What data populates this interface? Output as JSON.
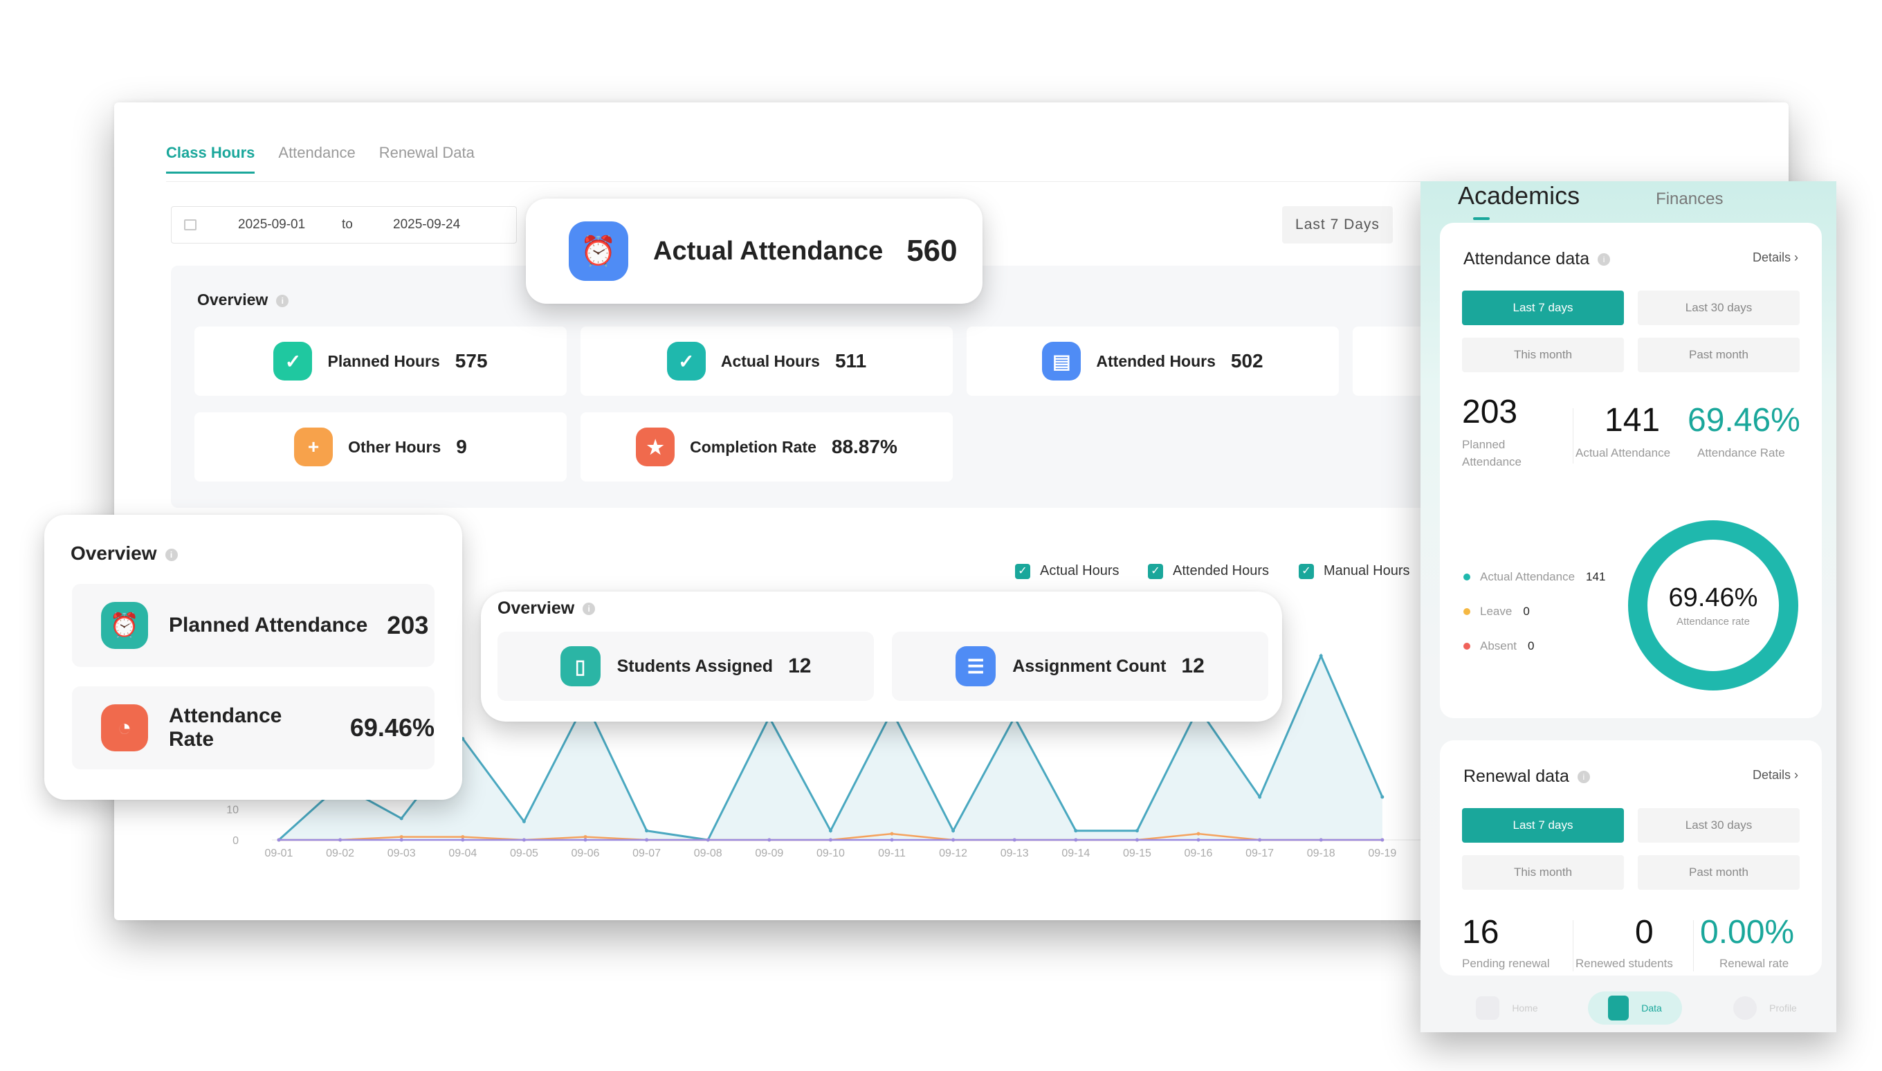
{
  "dashboard": {
    "tabs": [
      {
        "label": "Class Hours"
      },
      {
        "label": "Attendance"
      },
      {
        "label": "Renewal Data"
      }
    ],
    "date_range": {
      "start": "2025-09-01",
      "separator": "to",
      "end": "2025-09-24"
    },
    "range_button": "Last 7 Days",
    "overview": {
      "title": "Overview",
      "metrics": [
        {
          "label": "Planned Hours",
          "value": "575",
          "color": "#1fc8a0"
        },
        {
          "label": "Actual Hours",
          "value": "511",
          "color": "#1fb8ad"
        },
        {
          "label": "Attended Hours",
          "value": "502",
          "color": "#4f8cf5"
        },
        {
          "label": "Other Hours",
          "value": "9",
          "color": "#f7a24b"
        },
        {
          "label": "Completion Rate",
          "value": "88.87%",
          "color": "#f06a4d"
        }
      ]
    },
    "legend": [
      {
        "label": "Actual Hours"
      },
      {
        "label": "Attended Hours"
      },
      {
        "label": "Manual Hours"
      }
    ]
  },
  "chart_data": {
    "type": "area",
    "x": [
      "09-01",
      "09-02",
      "09-03",
      "09-04",
      "09-05",
      "09-06",
      "09-07",
      "09-08",
      "09-09",
      "09-10",
      "09-11",
      "09-12",
      "09-13",
      "09-14",
      "09-15",
      "09-16",
      "09-17",
      "09-18",
      "09-19"
    ],
    "yticks": [
      "0",
      "10"
    ],
    "ylim": [
      0,
      60
    ],
    "series": [
      {
        "name": "Actual Hours",
        "color": "#4aa8c0",
        "values": [
          0,
          18,
          7,
          33,
          6,
          45,
          3,
          0,
          40,
          3,
          42,
          3,
          40,
          3,
          3,
          43,
          14,
          60,
          14
        ]
      },
      {
        "name": "Attended Hours",
        "color": "#f5a25d",
        "values": [
          0,
          0,
          1,
          1,
          0,
          1,
          0,
          0,
          0,
          0,
          2,
          0,
          0,
          0,
          0,
          2,
          0,
          0,
          0
        ]
      },
      {
        "name": "Manual Hours",
        "color": "#9b8be0",
        "values": [
          0,
          0,
          0,
          0,
          0,
          0,
          0,
          0,
          0,
          0,
          0,
          0,
          0,
          0,
          0,
          0,
          0,
          0,
          0
        ]
      }
    ]
  },
  "actual_attendance_card": {
    "label": "Actual Attendance",
    "value": "560",
    "color": "#4f8cf5"
  },
  "overview_card": {
    "title": "Overview",
    "rows": [
      {
        "label": "Planned Attendance",
        "value": "203",
        "color": "#2bb5a5"
      },
      {
        "label": "Attendance Rate",
        "value": "69.46%",
        "color": "#f06a4d"
      }
    ]
  },
  "overview_card2": {
    "title": "Overview",
    "rows": [
      {
        "label": "Students Assigned",
        "value": "12",
        "color": "#2bb5a5"
      },
      {
        "label": "Assignment Count",
        "value": "12",
        "color": "#4f8cf5"
      }
    ]
  },
  "mobile": {
    "tabs": {
      "active": "Academics",
      "other": "Finances"
    },
    "attendance": {
      "title": "Attendance data",
      "details": "Details",
      "segments": [
        "Last 7 days",
        "Last 30 days",
        "This month",
        "Past month"
      ],
      "planned": {
        "value": "203",
        "caption1": "Planned",
        "caption2": "Attendance"
      },
      "actual": {
        "value": "141",
        "caption": "Actual Attendance"
      },
      "rate": {
        "value": "69.46%",
        "caption": "Attendance Rate"
      },
      "legend": [
        {
          "label": "Actual Attendance",
          "value": "141",
          "color": "#1fb8ad"
        },
        {
          "label": "Leave",
          "value": "0",
          "color": "#f5b843"
        },
        {
          "label": "Absent",
          "value": "0",
          "color": "#f0625a"
        }
      ],
      "donut": {
        "percent": "69.46%",
        "label": "Attendance rate",
        "color": "#1fb8ad"
      }
    },
    "renewal": {
      "title": "Renewal data",
      "details": "Details",
      "segments": [
        "Last 7 days",
        "Last 30 days",
        "This month",
        "Past month"
      ],
      "pending": {
        "value": "16",
        "caption": "Pending renewal"
      },
      "renewed": {
        "value": "0",
        "caption": "Renewed students"
      },
      "rate": {
        "value": "0.00%",
        "caption": "Renewal rate"
      }
    },
    "tabbar": [
      "Home",
      "Data",
      "Profile"
    ]
  }
}
